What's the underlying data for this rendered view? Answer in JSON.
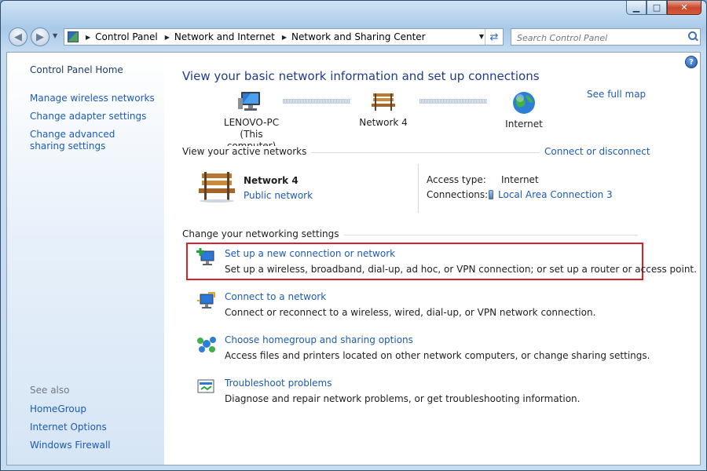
{
  "window": {
    "caption": {
      "minimize": "▁",
      "maximize": "□",
      "close": "✕"
    }
  },
  "nav": {
    "back_icon": "back-arrow-icon",
    "forward_icon": "forward-arrow-icon",
    "breadcrumbs": [
      "Control Panel",
      "Network and Internet",
      "Network and Sharing Center"
    ],
    "search_placeholder": "Search Control Panel"
  },
  "sidebar": {
    "home": "Control Panel Home",
    "tasks": [
      "Manage wireless networks",
      "Change adapter settings",
      "Change advanced sharing settings"
    ],
    "see_also_label": "See also",
    "see_also": [
      "HomeGroup",
      "Internet Options",
      "Windows Firewall"
    ]
  },
  "main": {
    "heading": "View your basic network information and set up connections",
    "see_full_map": "See full map",
    "map": {
      "computer_name": "LENOVO-PC",
      "computer_sub": "(This computer)",
      "network": "Network  4",
      "internet": "Internet"
    },
    "active": {
      "label": "View your active networks",
      "connect_link": "Connect or disconnect",
      "network_name": "Network  4",
      "network_type": "Public network",
      "access_type_label": "Access type:",
      "access_type_value": "Internet",
      "connections_label": "Connections:",
      "connections_value": "Local Area Connection 3"
    },
    "settings": {
      "label": "Change your networking settings",
      "tasks": [
        {
          "title": "Set up a new connection or network",
          "desc": "Set up a wireless, broadband, dial-up, ad hoc, or VPN connection; or set up a router or access point.",
          "icon": "new-connection-icon",
          "highlighted": true
        },
        {
          "title": "Connect to a network",
          "desc": "Connect or reconnect to a wireless, wired, dial-up, or VPN network connection.",
          "icon": "connect-network-icon",
          "highlighted": false
        },
        {
          "title": "Choose homegroup and sharing options",
          "desc": "Access files and printers located on other network computers, or change sharing settings.",
          "icon": "homegroup-icon",
          "highlighted": false
        },
        {
          "title": "Troubleshoot problems",
          "desc": "Diagnose and repair network problems, or get troubleshooting information.",
          "icon": "troubleshoot-icon",
          "highlighted": false
        }
      ]
    }
  },
  "colors": {
    "link": "#1c5bb3",
    "heading": "#1e3c8c",
    "highlight_border": "#dd1f26"
  }
}
